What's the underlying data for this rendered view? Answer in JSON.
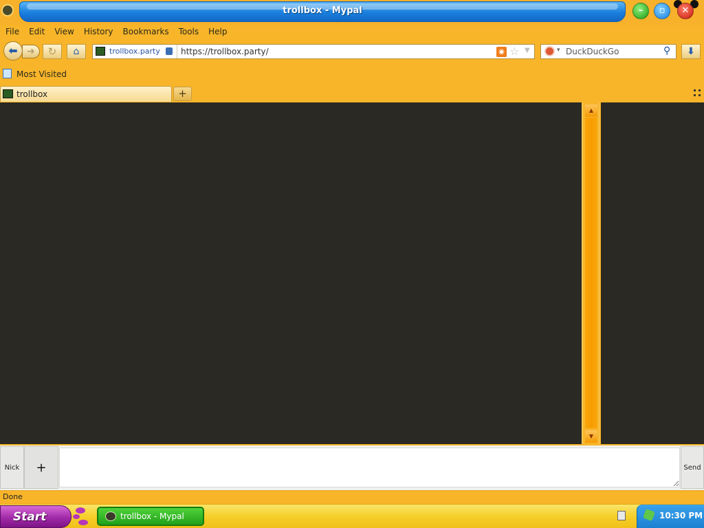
{
  "window": {
    "title": "trollbox - Mypal"
  },
  "menu": {
    "items": [
      "File",
      "Edit",
      "View",
      "History",
      "Bookmarks",
      "Tools",
      "Help"
    ]
  },
  "navbar": {
    "identity": "trollbox.party",
    "url": "https://trollbox.party/",
    "search_engine": "DuckDuckGo"
  },
  "bookmarks": {
    "items": [
      {
        "label": "Most Visited"
      }
    ]
  },
  "tabs": [
    {
      "label": "trollbox",
      "active": true
    }
  ],
  "newtab": {
    "label": "+"
  },
  "chat": {
    "nick_label": "Nick",
    "plus_label": "+",
    "message_value": "",
    "send_label": "Send"
  },
  "status": {
    "text": "Done"
  },
  "taskbar": {
    "start_label": "Start",
    "task_label": "trollbox - Mypal",
    "clock": "10:30 PM"
  },
  "colors": {
    "theme_orange": "#f8b52a",
    "chat_background": "#2a2924",
    "title_blue": "#1a7fde",
    "start_purple": "#a12aa8",
    "task_green": "#22a11a"
  }
}
